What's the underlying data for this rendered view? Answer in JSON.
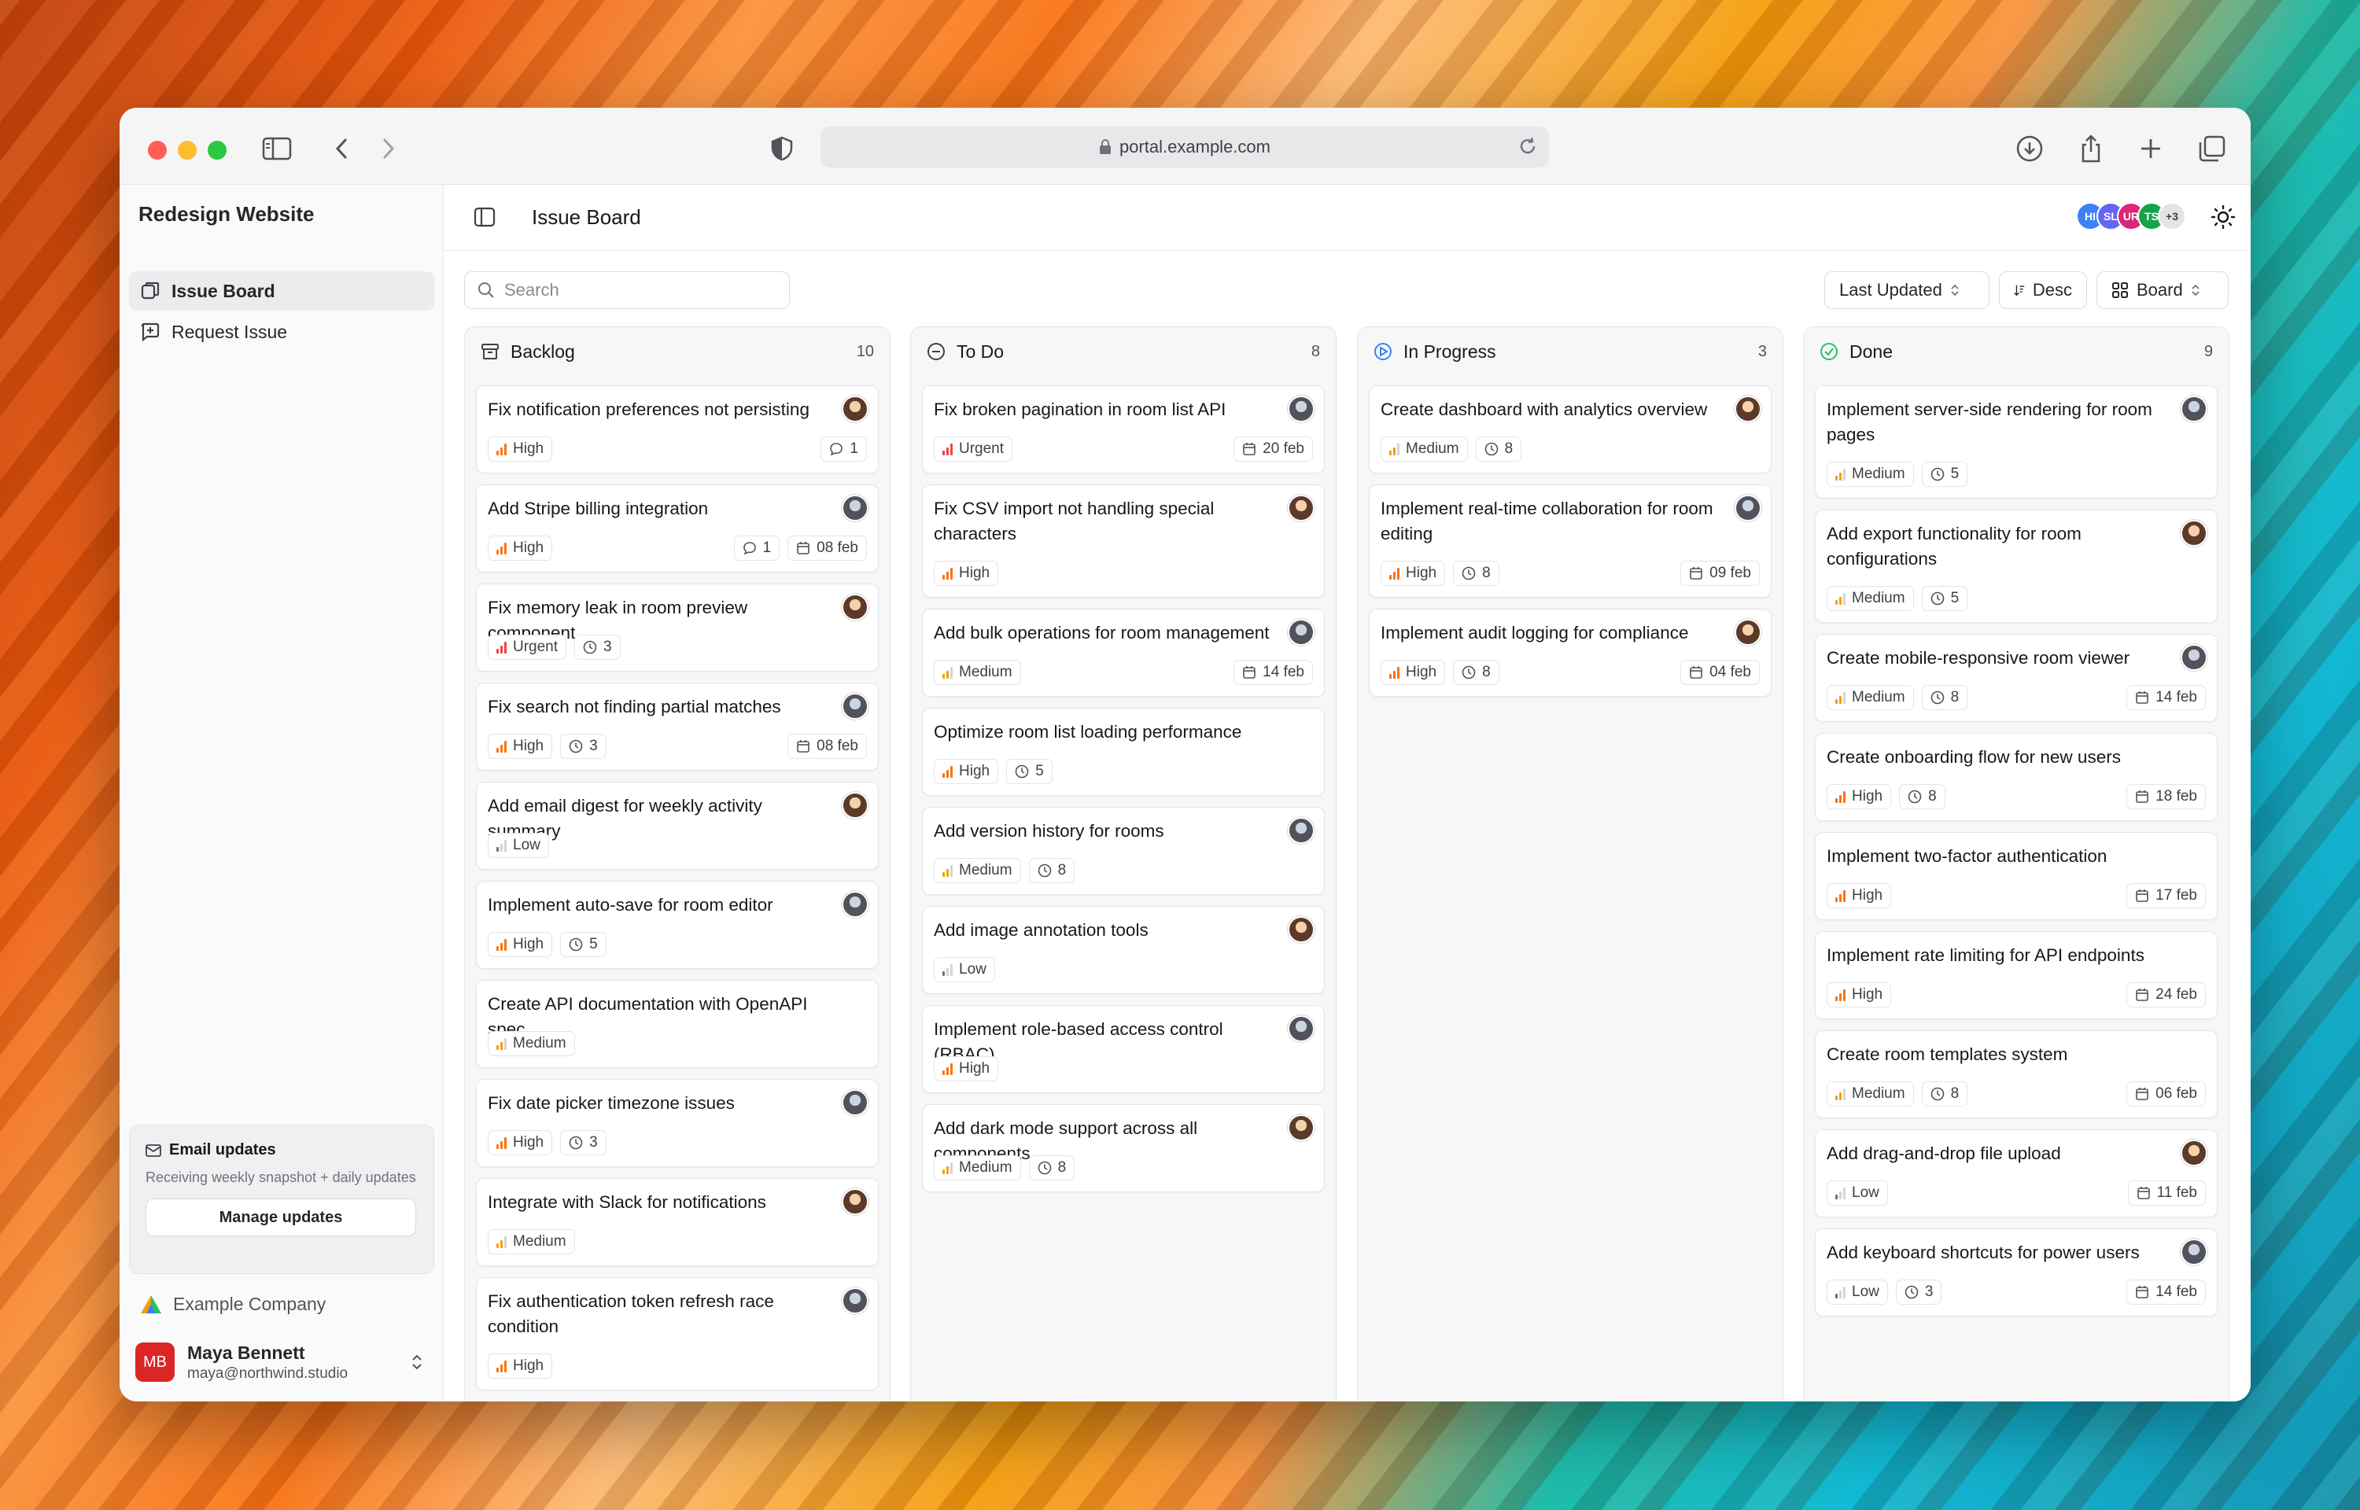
{
  "browser": {
    "url": "portal.example.com"
  },
  "sidebar": {
    "project": "Redesign Website",
    "items": [
      {
        "label": "Issue Board",
        "icon": "board-icon"
      },
      {
        "label": "Request Issue",
        "icon": "plus-square-icon"
      }
    ],
    "email": {
      "title": "Email updates",
      "description": "Receiving weekly snapshot + daily updates",
      "button": "Manage updates"
    },
    "company": "Example Company",
    "user": {
      "initials": "MB",
      "name": "Maya Bennett",
      "email": "maya@northwind.studio"
    }
  },
  "header": {
    "title": "Issue Board",
    "avatars": [
      "HI",
      "SL",
      "UR",
      "TS"
    ],
    "more": "+3"
  },
  "toolbar": {
    "search_placeholder": "Search",
    "sort": "Last Updated",
    "order": "Desc",
    "view": "Board"
  },
  "colors": {
    "urgent": "#ef4444",
    "high": "#f97316",
    "medium": "#f59e0b",
    "low": "#71717a"
  },
  "columns": [
    {
      "title": "Backlog",
      "count": "10",
      "icon": "archive-icon",
      "cards": [
        {
          "title": "Fix notification preferences not persisting",
          "priority": "High",
          "comments": "1"
        },
        {
          "title": "Add Stripe billing integration",
          "priority": "High",
          "comments": "1",
          "date": "08 feb"
        },
        {
          "title": "Fix memory leak in room preview component",
          "priority": "Urgent",
          "estimate": "3"
        },
        {
          "title": "Fix search not finding partial matches",
          "priority": "High",
          "estimate": "3",
          "date": "08 feb"
        },
        {
          "title": "Add email digest for weekly activity summary",
          "priority": "Low"
        },
        {
          "title": "Implement auto-save for room editor",
          "priority": "High",
          "estimate": "5"
        },
        {
          "title": "Create API documentation with OpenAPI spec",
          "priority": "Medium"
        },
        {
          "title": "Fix date picker timezone issues",
          "priority": "High",
          "estimate": "3"
        },
        {
          "title": "Integrate with Slack for notifications",
          "priority": "Medium"
        },
        {
          "title": "Fix authentication token refresh race condition",
          "priority": "High"
        }
      ]
    },
    {
      "title": "To Do",
      "count": "8",
      "icon": "circle-icon",
      "cards": [
        {
          "title": "Fix broken pagination in room list API",
          "priority": "Urgent",
          "date": "20 feb"
        },
        {
          "title": "Fix CSV import not handling special characters",
          "priority": "High"
        },
        {
          "title": "Add bulk operations for room management",
          "priority": "Medium",
          "date": "14 feb"
        },
        {
          "title": "Optimize room list loading performance",
          "priority": "High",
          "estimate": "5"
        },
        {
          "title": "Add version history for rooms",
          "priority": "Medium",
          "estimate": "8"
        },
        {
          "title": "Add image annotation tools",
          "priority": "Low"
        },
        {
          "title": "Implement role-based access control (RBAC)",
          "priority": "High"
        },
        {
          "title": "Add dark mode support across all components",
          "priority": "Medium",
          "estimate": "8"
        }
      ]
    },
    {
      "title": "In Progress",
      "count": "3",
      "icon": "play-circle-icon",
      "cards": [
        {
          "title": "Create dashboard with analytics overview",
          "priority": "Medium",
          "estimate": "8"
        },
        {
          "title": "Implement real-time collaboration for room editing",
          "priority": "High",
          "estimate": "8",
          "date": "09 feb"
        },
        {
          "title": "Implement audit logging for compliance",
          "priority": "High",
          "estimate": "8",
          "date": "04 feb"
        }
      ]
    },
    {
      "title": "Done",
      "count": "9",
      "icon": "check-circle-icon",
      "cards": [
        {
          "title": "Implement server-side rendering for room pages",
          "priority": "Medium",
          "estimate": "5"
        },
        {
          "title": "Add export functionality for room configurations",
          "priority": "Medium",
          "estimate": "5"
        },
        {
          "title": "Create mobile-responsive room viewer",
          "priority": "Medium",
          "estimate": "8",
          "date": "14 feb"
        },
        {
          "title": "Create onboarding flow for new users",
          "priority": "High",
          "estimate": "8",
          "date": "18 feb"
        },
        {
          "title": "Implement two-factor authentication",
          "priority": "High",
          "date": "17 feb"
        },
        {
          "title": "Implement rate limiting for API endpoints",
          "priority": "High",
          "date": "24 feb"
        },
        {
          "title": "Create room templates system",
          "priority": "Medium",
          "estimate": "8",
          "date": "06 feb"
        },
        {
          "title": "Add drag-and-drop file upload",
          "priority": "Low",
          "date": "11 feb"
        },
        {
          "title": "Add keyboard shortcuts for power users",
          "priority": "Low",
          "estimate": "3",
          "date": "14 feb"
        }
      ]
    }
  ]
}
